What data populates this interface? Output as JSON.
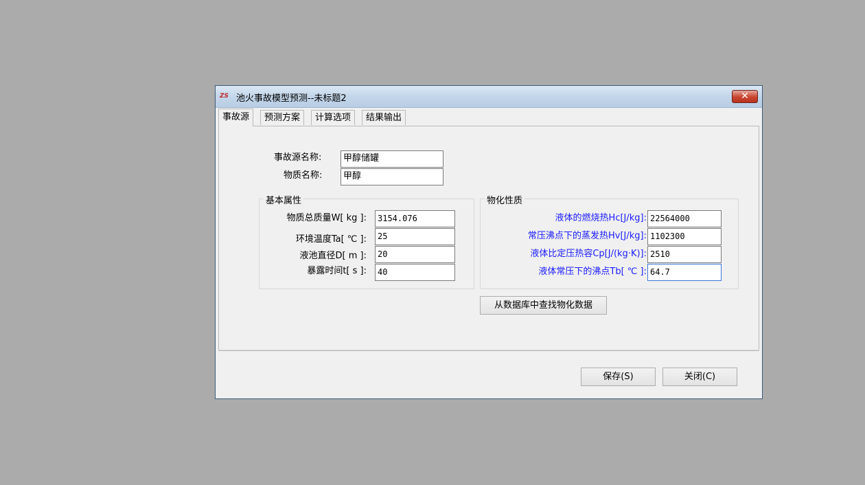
{
  "window": {
    "title": "池火事故模型预测--未标题2",
    "app_icon": "ZS",
    "close_glyph": "✕"
  },
  "tabs": [
    {
      "label": "事故源"
    },
    {
      "label": "预测方案"
    },
    {
      "label": "计算选项"
    },
    {
      "label": "结果输出"
    }
  ],
  "source": {
    "name_label": "事故源名称:",
    "name_value": "甲醇储罐",
    "substance_label": "物质名称:",
    "substance_value": "甲醇"
  },
  "basic": {
    "title": "基本属性",
    "fields": [
      {
        "label": "物质总质量W[ kg ]:",
        "value": "3154.076"
      },
      {
        "label": "环境温度Ta[ ℃ ]:",
        "value": "25"
      },
      {
        "label": "液池直径D[  m ]:",
        "value": "20"
      },
      {
        "label": "暴露时间t[ s ]:",
        "value": "40"
      }
    ]
  },
  "physchem": {
    "title": "物化性质",
    "fields": [
      {
        "label": "液体的燃烧热Hc[J/kg]:",
        "value": "22564000"
      },
      {
        "label": "常压沸点下的蒸发热Hv[J/kg]:",
        "value": "1102300"
      },
      {
        "label": "液体比定压热容Cp[J/(kg·K)]:",
        "value": "2510"
      },
      {
        "label": "液体常压下的沸点Tb[ ℃ ]:",
        "value": "64.7"
      }
    ],
    "lookup_button": "从数据库中查找物化数据"
  },
  "footer": {
    "save_label": "保存(S)",
    "close_label": "关闭(C)"
  },
  "colors": {
    "desktop": "#ababab",
    "highlight_label": "#1a1aff",
    "close_button": "#c9452f"
  }
}
